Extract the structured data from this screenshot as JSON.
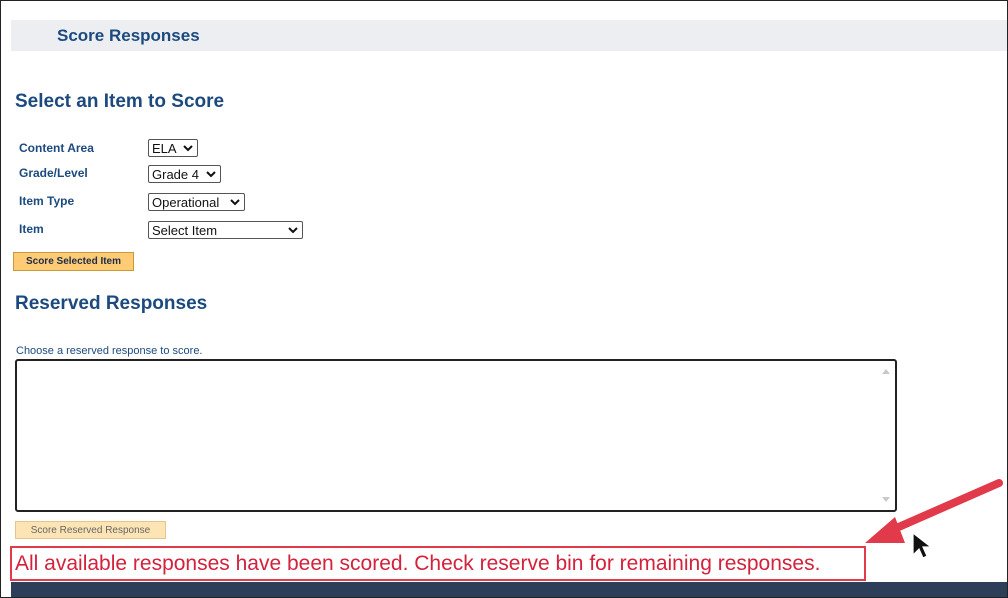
{
  "header": {
    "title": "Score Responses"
  },
  "select_section": {
    "heading": "Select an Item to Score",
    "fields": [
      {
        "label": "Content Area",
        "value": "ELA"
      },
      {
        "label": "Grade/Level",
        "value": "Grade 4"
      },
      {
        "label": "Item Type",
        "value": "Operational"
      },
      {
        "label": "Item",
        "value": "Select Item"
      }
    ],
    "score_button_label": "Score Selected Item"
  },
  "reserved_section": {
    "heading": "Reserved Responses",
    "hint": "Choose a reserved response to score.",
    "score_button_label": "Score Reserved Response"
  },
  "message": {
    "text": "All available responses have been scored.  Check reserve bin for remaining responses."
  },
  "colors": {
    "heading": "#1c4a7e",
    "button": "#ffcb74",
    "message": "#d4213c",
    "annotation": "#e03a4b",
    "footer": "#2c3e58"
  },
  "icons": {
    "dropdown": "chevron-down-icon",
    "annotation": "arrow-icon",
    "pointer": "mouse-cursor-icon"
  }
}
